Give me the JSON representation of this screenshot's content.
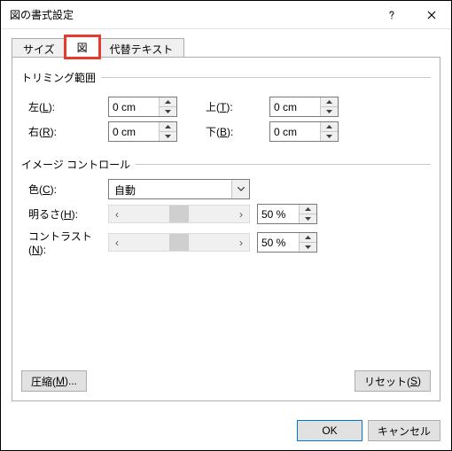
{
  "title": "図の書式設定",
  "tabs": {
    "size": "サイズ",
    "picture": "図",
    "alt": "代替テキスト"
  },
  "trim": {
    "heading": "トリミング範囲",
    "left_label_pre": "左(",
    "left_key": "L",
    "left_label_post": "):",
    "right_label_pre": "右(",
    "right_key": "R",
    "right_label_post": "):",
    "top_label_pre": "上(",
    "top_key": "T",
    "top_label_post": "):",
    "bottom_label_pre": "下(",
    "bottom_key": "B",
    "bottom_label_post": "):",
    "left": "0 cm",
    "right": "0 cm",
    "top": "0 cm",
    "bottom": "0 cm"
  },
  "img": {
    "heading": "イメージ コントロール",
    "color_label_pre": "色(",
    "color_key": "C",
    "color_label_post": "):",
    "color_value": "自動",
    "bright_label_pre": "明るさ(",
    "bright_key": "H",
    "bright_label_post": "):",
    "bright_value": "50 %",
    "contrast_label_pre": "コントラスト(",
    "contrast_key": "N",
    "contrast_label_post": "):",
    "contrast_value": "50 %"
  },
  "buttons": {
    "compress_pre": "圧縮(",
    "compress_key": "M",
    "compress_post": ")...",
    "reset_pre": "リセット(",
    "reset_key": "S",
    "reset_post": ")",
    "ok": "OK",
    "cancel": "キャンセル"
  }
}
